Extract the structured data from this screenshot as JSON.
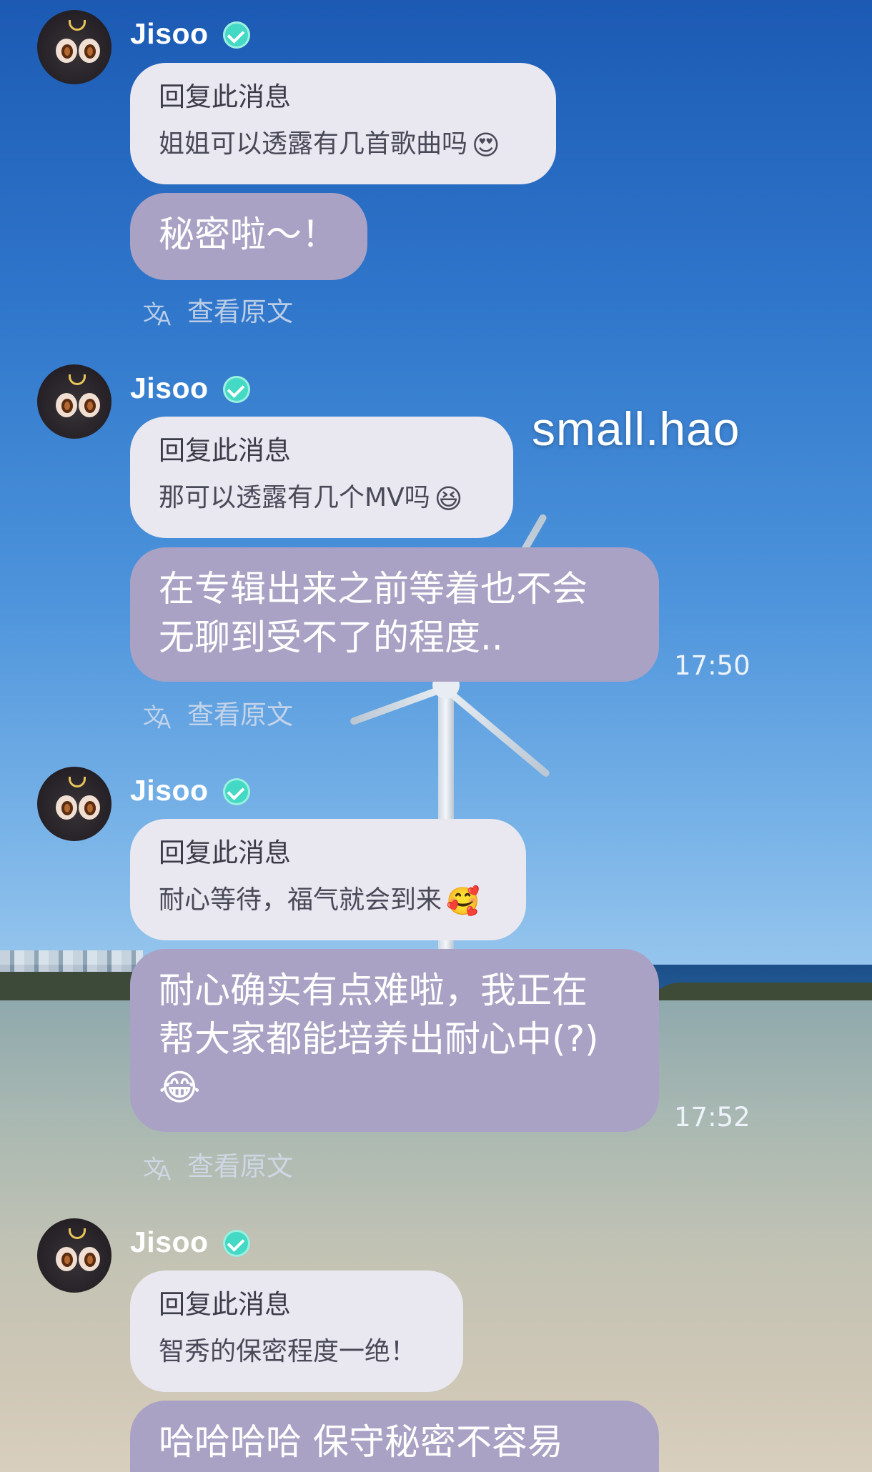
{
  "watermark": "small.hao",
  "messages": [
    {
      "sender": "Jisoo",
      "verified": true,
      "quote_title": "回复此消息",
      "quote_body": "姐姐可以透露有几首歌曲吗",
      "quote_emoji": "😍",
      "reply": "秘密啦～！",
      "time": "",
      "translate_label": "查看原文"
    },
    {
      "sender": "Jisoo",
      "verified": true,
      "quote_title": "回复此消息",
      "quote_body": "那可以透露有几个MV吗",
      "quote_emoji": "😆",
      "reply_line1": "在专辑出来之前等着也不会",
      "reply_line2": "无聊到受不了的程度..",
      "time": "17:50",
      "translate_label": "查看原文"
    },
    {
      "sender": "Jisoo",
      "verified": true,
      "quote_title": "回复此消息",
      "quote_body": "耐心等待，福气就会到来",
      "quote_emoji": "🥰",
      "reply_line1": "耐心确实有点难啦，我正在",
      "reply_line2": "帮大家都能培养出耐心中(?)",
      "reply_emoji": "😂",
      "time": "17:52",
      "translate_label": "查看原文"
    },
    {
      "sender": "Jisoo",
      "verified": true,
      "quote_title": "回复此消息",
      "quote_body": "智秀的保密程度一绝！",
      "reply": "哈哈哈哈 保守秘密不容易"
    }
  ],
  "colors": {
    "reply_bubble": "#a9a2c4",
    "quote_bubble": "#e9e8f1",
    "verified_badge": "#43d9c4"
  }
}
